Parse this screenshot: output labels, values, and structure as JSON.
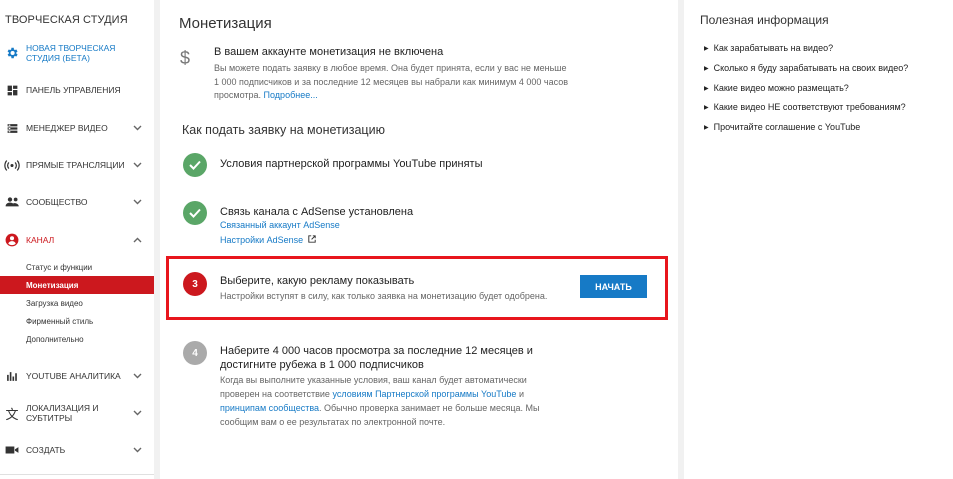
{
  "sidebar": {
    "title": "ТВОРЧЕСКАЯ СТУДИЯ",
    "items": [
      {
        "label": "НОВАЯ ТВОРЧЕСКАЯ СТУДИЯ (БЕТА)",
        "icon": "gear-icon"
      },
      {
        "label": "ПАНЕЛЬ УПРАВЛЕНИЯ",
        "icon": "dashboard-icon"
      },
      {
        "label": "МЕНЕДЖЕР ВИДЕО",
        "icon": "video-manager-icon"
      },
      {
        "label": "ПРЯМЫЕ ТРАНСЛЯЦИИ",
        "icon": "broadcast-icon"
      },
      {
        "label": "СООБЩЕСТВО",
        "icon": "community-icon"
      },
      {
        "label": "КАНАЛ",
        "icon": "channel-icon"
      },
      {
        "label": "YOUTUBE АНАЛИТИКА",
        "icon": "analytics-icon"
      },
      {
        "label": "ЛОКАЛИЗАЦИЯ И СУБТИТРЫ",
        "icon": "translate-icon"
      },
      {
        "label": "СОЗДАТЬ",
        "icon": "camera-icon"
      }
    ],
    "channel_sub": [
      "Статус и функции",
      "Монетизация",
      "Загрузка видео",
      "Фирменный стиль",
      "Дополнительно"
    ]
  },
  "main": {
    "title": "Монетизация",
    "notice": {
      "icon": "dollar-icon",
      "heading": "В вашем аккаунте монетизация не включена",
      "body": "Вы можете подать заявку в любое время. Она будет принята, если у вас не меньше 1 000 подписчиков и за последние 12 месяцев вы набрали как минимум 4 000 часов просмотра.",
      "more_link": "Подробнее..."
    },
    "how_title": "Как подать заявку на монетизацию",
    "steps": [
      {
        "title": "Условия партнерской программы YouTube приняты"
      },
      {
        "title": "Связь канала с AdSense установлена",
        "link1": "Связанный аккаунт AdSense",
        "link2": "Настройки AdSense"
      },
      {
        "number": "3",
        "title": "Выберите, какую рекламу показывать",
        "text": "Настройки вступят в силу, как только заявка на монетизацию будет одобрена.",
        "button": "НАЧАТЬ"
      },
      {
        "number": "4",
        "title_line1": "Наберите 4 000 часов просмотра за последние 12 месяцев и",
        "title_line2": "достигните рубежа в 1 000 подписчиков",
        "text_line1": "Когда вы выполните указанные условия, ваш канал будет автоматически",
        "text_line2a": "проверен на соответствие",
        "link_a": "условиям Партнерской программы YouTube",
        "text_line2b": "и",
        "link_b": "принципам сообщества",
        "text_line3a": ". Обычно проверка занимает не больше месяца. Мы",
        "text_line4": "сообщим вам о ее результатах по электронной почте."
      }
    ]
  },
  "info": {
    "title": "Полезная информация",
    "items": [
      "Как зарабатывать на видео?",
      "Сколько я буду зарабатывать на своих видео?",
      "Какие видео можно размещать?",
      "Какие видео НЕ соответствуют требованиям?",
      "Прочитайте соглашение с YouTube"
    ]
  },
  "colors": {
    "accent_red": "#cc181e",
    "link_blue": "#167ac6",
    "check_green": "#5aa667",
    "highlight_box": "#e8161d"
  }
}
